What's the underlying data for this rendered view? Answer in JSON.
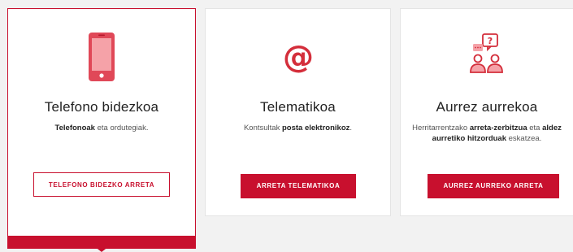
{
  "accent_color": "#c8102e",
  "cards": [
    {
      "icon": "smartphone-icon",
      "title": "Telefono bidezkoa",
      "desc_parts": [
        {
          "text": "Telefonoak",
          "bold": true
        },
        {
          "text": " eta ordutegiak.",
          "bold": false
        }
      ],
      "button_label": "TELEFONO BIDEZKO ARRETA",
      "active": true
    },
    {
      "icon": "at-sign-icon",
      "title": "Telematikoa",
      "desc_parts": [
        {
          "text": "Kontsultak ",
          "bold": false
        },
        {
          "text": "posta elektronikoz",
          "bold": true
        },
        {
          "text": ".",
          "bold": false
        }
      ],
      "button_label": "ARRETA TELEMATIKOA",
      "active": false
    },
    {
      "icon": "people-chat-icon",
      "title": "Aurrez aurrekoa",
      "desc_parts": [
        {
          "text": "Herritarrentzako ",
          "bold": false
        },
        {
          "text": "arreta-zerbitzua",
          "bold": true
        },
        {
          "text": " eta ",
          "bold": false
        },
        {
          "text": "aldez aurretiko hitzorduak",
          "bold": true
        },
        {
          "text": " eskatzea.",
          "bold": false
        }
      ],
      "button_label": "AURREZ AURREKO ARRETA",
      "active": false
    }
  ]
}
